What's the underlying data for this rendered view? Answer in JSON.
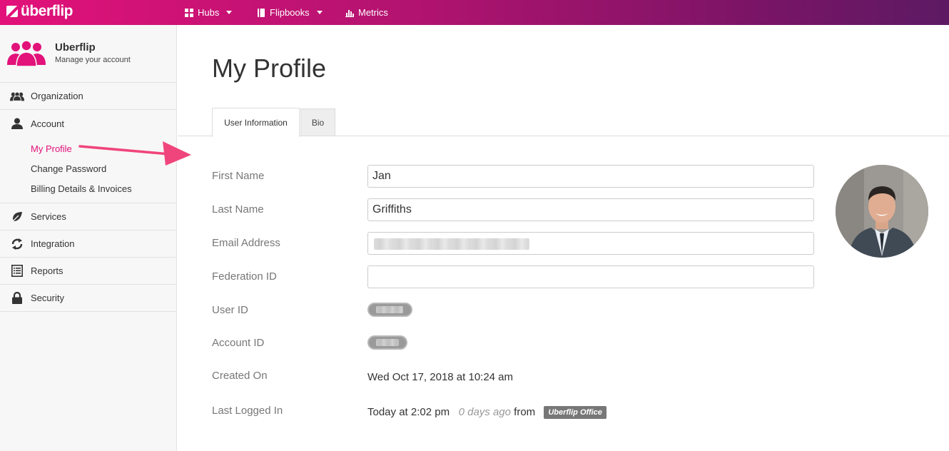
{
  "topbar": {
    "logo": "überflip",
    "nav": [
      {
        "label": "Hubs",
        "icon": "grid-icon",
        "dropdown": true
      },
      {
        "label": "Flipbooks",
        "icon": "book-icon",
        "dropdown": true
      },
      {
        "label": "Metrics",
        "icon": "bar-chart-icon",
        "dropdown": false
      }
    ]
  },
  "sidebar": {
    "brand_title": "Uberflip",
    "brand_subtitle": "Manage your account",
    "items": [
      {
        "label": "Organization",
        "icon": "users-icon"
      },
      {
        "label": "Account",
        "icon": "user-icon"
      },
      {
        "label": "Services",
        "icon": "leaf-icon"
      },
      {
        "label": "Integration",
        "icon": "refresh-icon"
      },
      {
        "label": "Reports",
        "icon": "list-icon"
      },
      {
        "label": "Security",
        "icon": "lock-icon"
      }
    ],
    "account_sub": [
      {
        "label": "My Profile",
        "active": true
      },
      {
        "label": "Change Password",
        "active": false
      },
      {
        "label": "Billing Details & Invoices",
        "active": false
      }
    ]
  },
  "main": {
    "title": "My Profile",
    "tabs": [
      {
        "label": "User Information",
        "active": true
      },
      {
        "label": "Bio",
        "active": false
      }
    ],
    "fields": {
      "first_name_label": "First Name",
      "first_name_value": "Jan",
      "last_name_label": "Last Name",
      "last_name_value": "Griffiths",
      "email_label": "Email Address",
      "federation_label": "Federation ID",
      "federation_value": "",
      "user_id_label": "User ID",
      "account_id_label": "Account ID",
      "created_label": "Created On",
      "created_value": "Wed Oct 17, 2018 at 10:24 am",
      "last_login_label": "Last Logged In",
      "last_login_time": "Today at 2:02 pm",
      "last_login_ago": "0 days ago",
      "last_login_from": "from",
      "last_login_location": "Uberflip Office"
    }
  },
  "colors": {
    "brand_pink": "#e2127a",
    "topbar_end": "#5c1a63",
    "arrow": "#f0457c"
  }
}
